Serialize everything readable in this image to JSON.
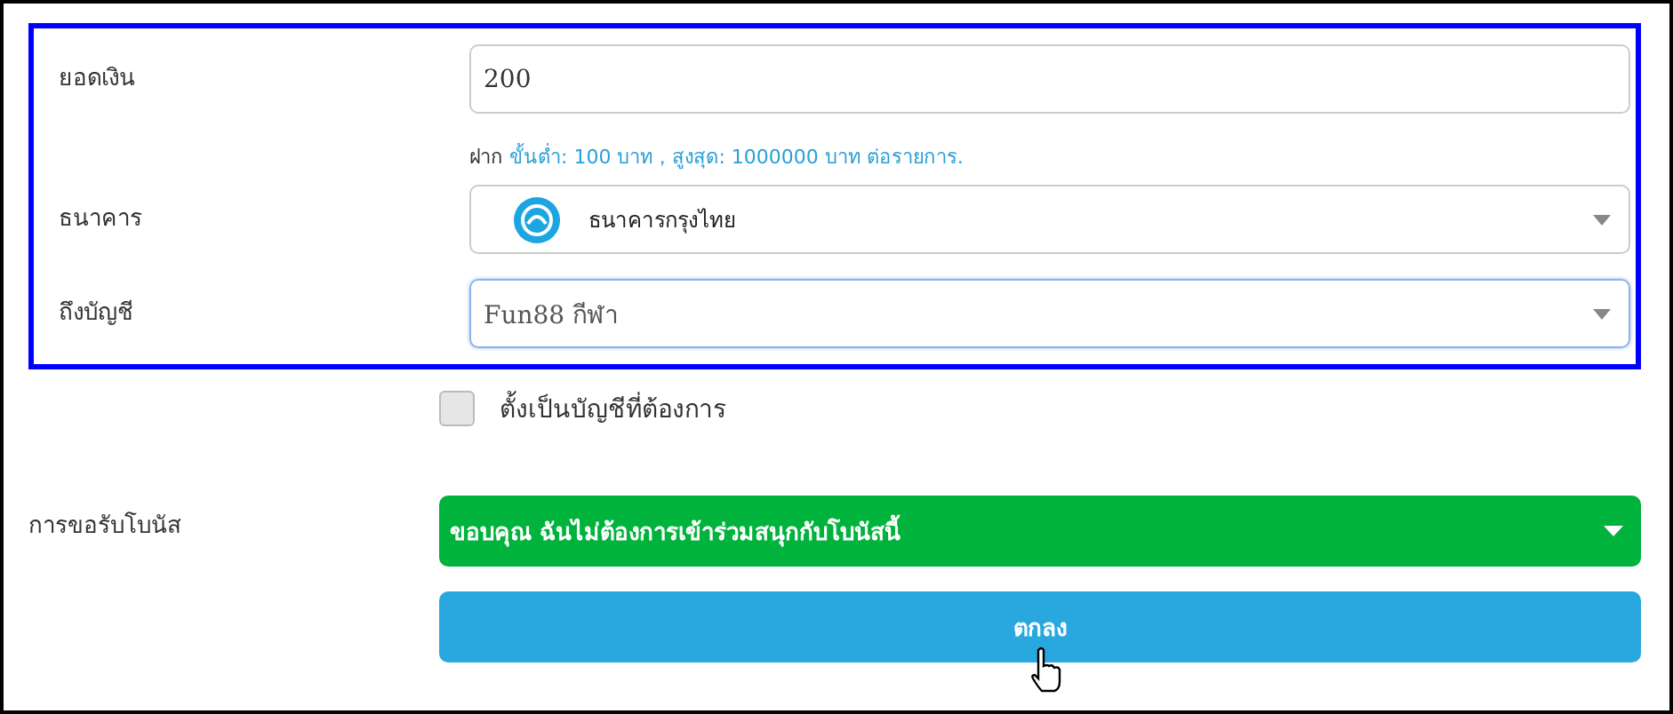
{
  "amount": {
    "label": "ยอดเงิน",
    "value": "200"
  },
  "hint": {
    "prefix": "ฝาก",
    "text": "ขั้นต่ำ:  100 บาท，สูงสุด:  1000000 บาท ต่อรายการ."
  },
  "bank": {
    "label": "ธนาคาร",
    "value": "ธนาคารกรุงไทย"
  },
  "account": {
    "label": "ถึงบัญชี",
    "value": "Fun88 กีฬา",
    "focused": true
  },
  "default_account": {
    "label": "ตั้งเป็นบัญชีที่ต้องการ",
    "checked": false
  },
  "bonus": {
    "label": "การขอรับโบนัส",
    "value": "ขอบคุณ ฉันไม่ต้องการเข้าร่วมสนุกกับโบนัสนี้"
  },
  "submit": {
    "label": "ตกลง"
  }
}
